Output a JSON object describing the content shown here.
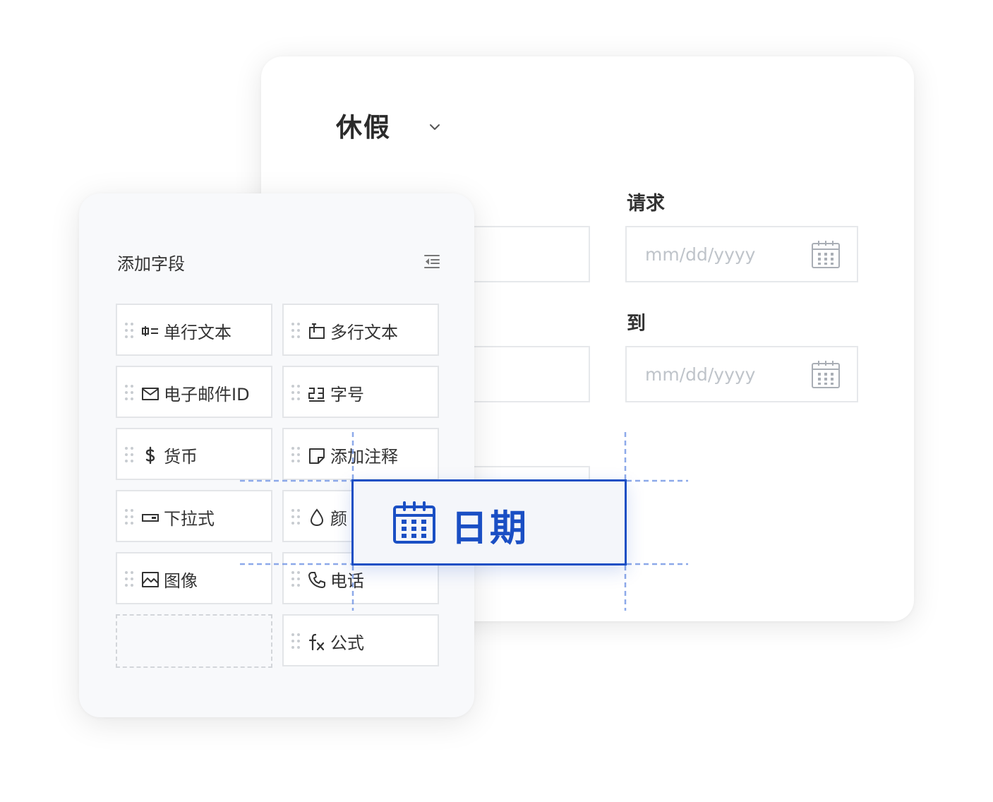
{
  "form": {
    "title": "休假",
    "fields": [
      {
        "label": "请求",
        "placeholder": "mm/dd/yyyy"
      },
      {
        "label": "到",
        "placeholder": "mm/dd/yyyy"
      }
    ]
  },
  "panel": {
    "title": "添加字段",
    "items": [
      {
        "label": "单行文本",
        "icon": "single-line-icon"
      },
      {
        "label": "多行文本",
        "icon": "multi-line-icon"
      },
      {
        "label": "电子邮件ID",
        "icon": "mail-icon"
      },
      {
        "label": "字号",
        "icon": "number-icon"
      },
      {
        "label": "货币",
        "icon": "dollar-icon"
      },
      {
        "label": "添加注释",
        "icon": "note-icon"
      },
      {
        "label": "下拉式",
        "icon": "dropdown-icon"
      },
      {
        "label": "颜",
        "icon": "droplet-icon"
      },
      {
        "label": "图像",
        "icon": "image-icon"
      },
      {
        "label": "电话",
        "icon": "phone-icon"
      },
      {
        "label": "公式",
        "icon": "formula-icon"
      }
    ]
  },
  "drag": {
    "label": "日期",
    "icon": "calendar-icon"
  },
  "colors": {
    "accent": "#1a4fc4",
    "panel_bg": "#f8f9fb",
    "border": "#e3e5e8",
    "placeholder": "#bfc4ca"
  }
}
